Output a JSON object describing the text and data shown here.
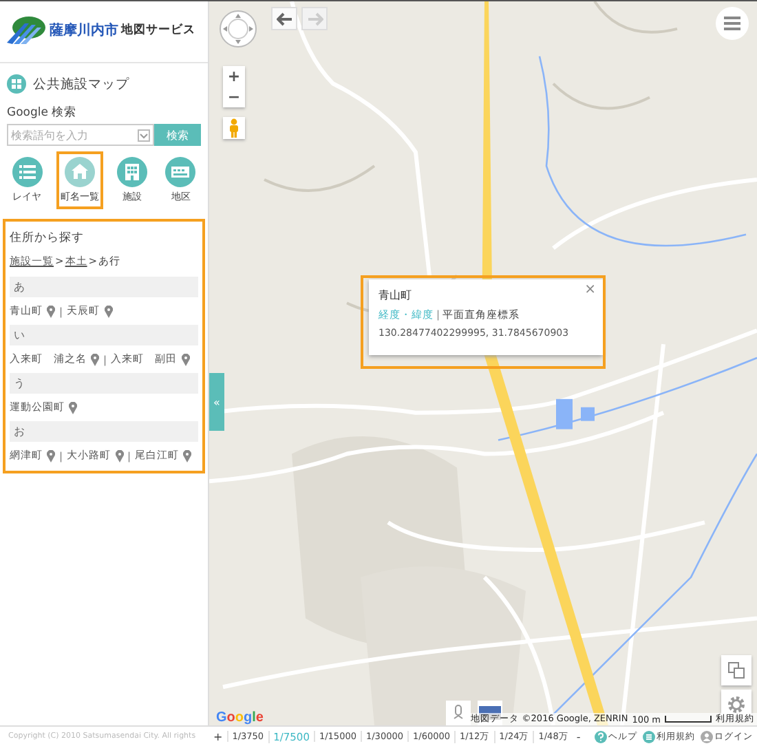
{
  "header": {
    "city": "薩摩川内市",
    "service": "地図サービス"
  },
  "map_title": "公共施設マップ",
  "search": {
    "label": "Google 検索",
    "placeholder": "検索語句を入力",
    "button": "検索"
  },
  "tool_buttons": [
    {
      "label": "レイヤ",
      "kind": "list",
      "selected": false
    },
    {
      "label": "町名一覧",
      "kind": "home",
      "selected": true
    },
    {
      "label": "施設",
      "kind": "building",
      "selected": false
    },
    {
      "label": "地区",
      "kind": "district",
      "selected": false
    }
  ],
  "address_panel": {
    "title": "住所から探す",
    "separator": ">",
    "town_separator": "|",
    "breadcrumb": [
      {
        "label": "施設一覧",
        "link": true
      },
      {
        "label": "本土",
        "link": true
      },
      {
        "label": "あ行",
        "link": false
      }
    ],
    "groups": [
      {
        "heading": "あ",
        "towns": [
          "青山町",
          "天辰町"
        ]
      },
      {
        "heading": "い",
        "towns": [
          "入来町　浦之名",
          "入来町　副田"
        ]
      },
      {
        "heading": "う",
        "towns": [
          "運動公園町"
        ]
      },
      {
        "heading": "お",
        "towns": [
          "網津町",
          "大小路町",
          "尾白江町"
        ]
      }
    ]
  },
  "map": {
    "back_enabled": true,
    "forward_enabled": false,
    "zoom_in": "+",
    "zoom_out": "−",
    "collapse": "«",
    "popup": {
      "title": "青山町",
      "link": "経度・緯度",
      "separator": "|",
      "system": "平面直角座標系",
      "coordinates": "130.28477402299995, 31.7845670903",
      "close": "×"
    },
    "logo": "Google",
    "attribution": "地図データ ©2016 Google, ZENRIN",
    "scale": "100 m",
    "terms": "利用規約"
  },
  "status_bar": {
    "copyright": "Copyright (C) 2010 Satsumasendai City. All rights",
    "zoom_in": "+",
    "zoom_out": "-",
    "scales": [
      {
        "label": "1/3750",
        "selected": false
      },
      {
        "label": "1/7500",
        "selected": true
      },
      {
        "label": "1/15000",
        "selected": false
      },
      {
        "label": "1/30000",
        "selected": false
      },
      {
        "label": "1/60000",
        "selected": false
      },
      {
        "label": "1/12万",
        "selected": false
      },
      {
        "label": "1/24万",
        "selected": false
      },
      {
        "label": "1/48万",
        "selected": false
      }
    ],
    "links": [
      {
        "label": "ヘルプ",
        "kind": "help"
      },
      {
        "label": "利用規約",
        "kind": "terms"
      },
      {
        "label": "ログイン",
        "kind": "login"
      }
    ]
  }
}
